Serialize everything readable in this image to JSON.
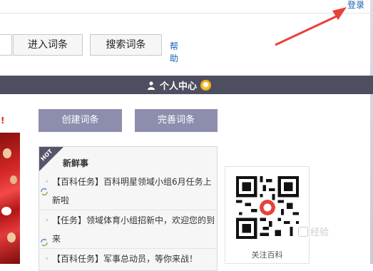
{
  "header": {
    "login_label": "登录"
  },
  "search": {
    "clear_symbol": "×",
    "enter_label": "进入词条",
    "search_label": "搜索词条",
    "help_label": "帮助"
  },
  "nav": {
    "personal_center_label": "个人中心"
  },
  "left": {
    "edge_mark": "!"
  },
  "actions": {
    "create_label": "创建词条",
    "improve_label": "完善词条"
  },
  "news": {
    "badge": "HOT",
    "title": "新鲜事",
    "lines": [
      "【百科任务】百科明星领域小组6月任务上",
      "新啦",
      "【任务】领域体育小组招新中，欢迎您的到",
      "来",
      "【百科任务】军事总动员，等你来战！"
    ]
  },
  "qr": {
    "caption": "关注百科"
  },
  "watermark": {
    "text": "经验"
  },
  "colors": {
    "nav_bg": "#4e4e61",
    "action_btn": "#8d8eae",
    "link": "#1a5fb4",
    "arrow": "#e8413a"
  }
}
